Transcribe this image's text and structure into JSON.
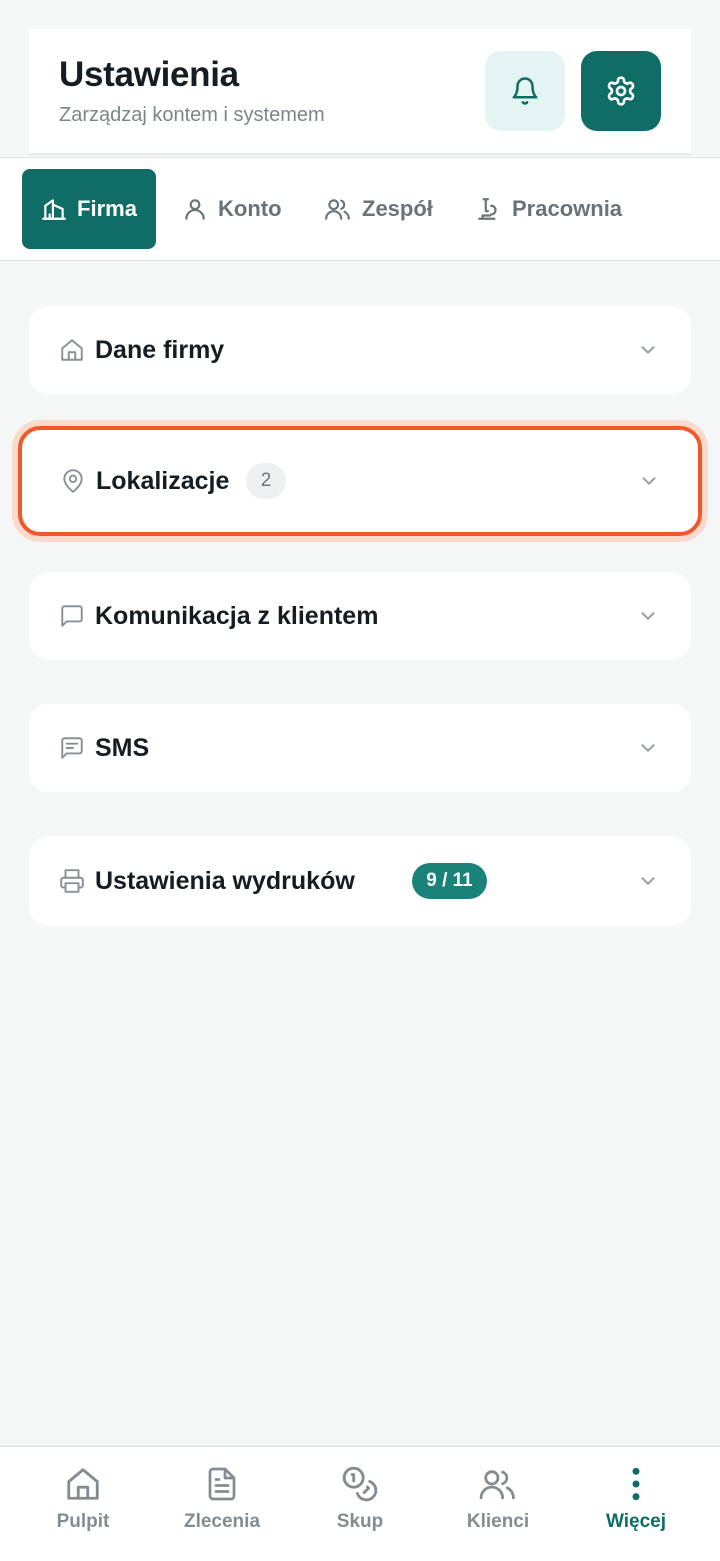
{
  "header": {
    "title": "Ustawienia",
    "subtitle": "Zarządzaj kontem i systemem",
    "bell_icon": "bell-icon",
    "settings_icon": "gear-icon"
  },
  "tabs": [
    {
      "label": "Firma",
      "icon": "building-icon",
      "active": true
    },
    {
      "label": "Konto",
      "icon": "user-icon",
      "active": false
    },
    {
      "label": "Zespół",
      "icon": "users-icon",
      "active": false
    },
    {
      "label": "Pracownia",
      "icon": "microscope-icon",
      "active": false
    }
  ],
  "sections": [
    {
      "label": "Dane firmy",
      "icon": "home-icon"
    },
    {
      "label": "Lokalizacje",
      "icon": "map-pin-icon",
      "badge": "2"
    },
    {
      "label": "Komunikacja z klientem",
      "icon": "message-square-icon"
    },
    {
      "label": "SMS",
      "icon": "message-text-icon"
    },
    {
      "label": "Ustawienia wydruków",
      "icon": "printer-icon",
      "badge": "9 / 11"
    }
  ],
  "bottom_nav": [
    {
      "label": "Pulpit",
      "icon": "home-icon"
    },
    {
      "label": "Zlecenia",
      "icon": "document-icon"
    },
    {
      "label": "Skup",
      "icon": "coins-icon"
    },
    {
      "label": "Klienci",
      "icon": "users-icon"
    },
    {
      "label": "Więcej",
      "icon": "more-vertical-icon",
      "active": true
    }
  ],
  "colors": {
    "accent": "#0f6d66",
    "accent_light": "#e3f4f2",
    "highlight": "#f05a28",
    "background": "#f5f6f6"
  }
}
